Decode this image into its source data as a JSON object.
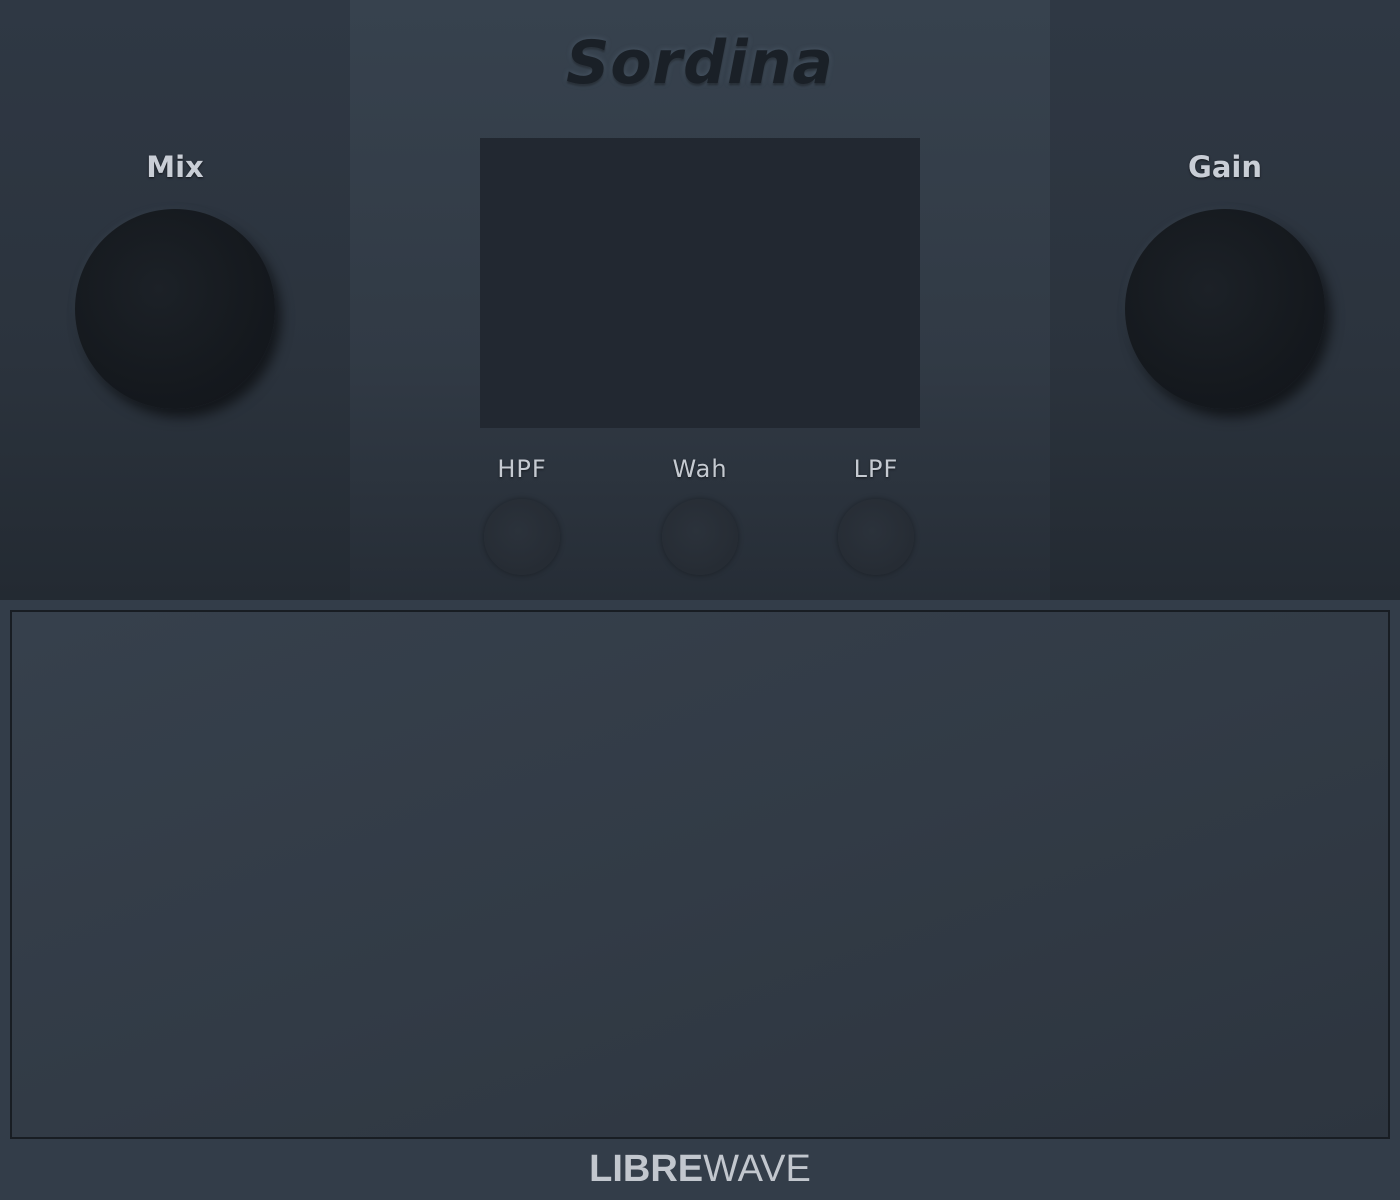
{
  "app": {
    "title": "Sordina"
  },
  "controls": {
    "mix_label": "Mix",
    "gain_label": "Gain",
    "hpf_label": "HPF",
    "wah_label": "Wah",
    "lpf_label": "LPF"
  },
  "brand": {
    "logo_bold": "LIBRE",
    "logo_light": "WAVE"
  },
  "colors": {
    "background": "#333d49",
    "knob": "#15191e",
    "display": "#222831",
    "label": "#c9ced6"
  }
}
